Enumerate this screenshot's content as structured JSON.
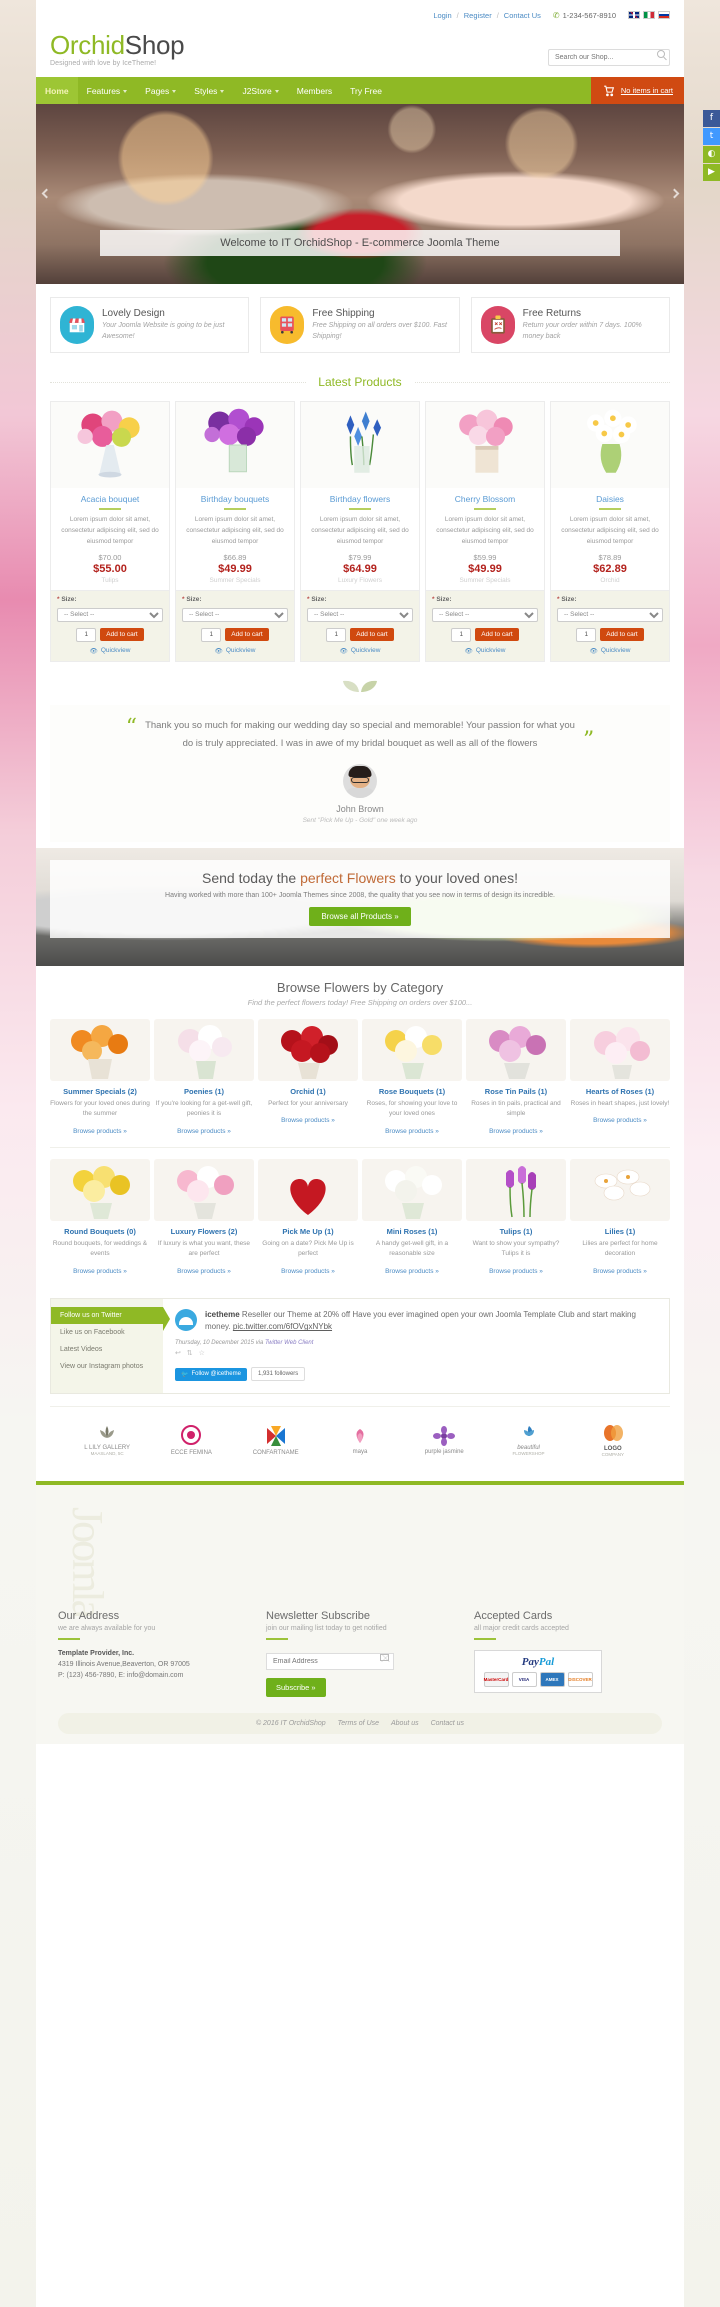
{
  "topbar": {
    "login": "Login",
    "register": "Register",
    "contact": "Contact Us",
    "phone": "1-234-567-8910",
    "separator": "/",
    "flags": [
      "flag-uk",
      "flag-it",
      "flag-ru"
    ]
  },
  "header": {
    "logo_part1": "Orchid",
    "logo_part2": "Shop",
    "tagline": "Designed with love by IceTheme!",
    "search_placeholder": "Search our Shop..."
  },
  "nav": {
    "items": [
      {
        "label": "Home",
        "caret": false,
        "active": true
      },
      {
        "label": "Features",
        "caret": true,
        "active": false
      },
      {
        "label": "Pages",
        "caret": true,
        "active": false
      },
      {
        "label": "Styles",
        "caret": true,
        "active": false
      },
      {
        "label": "J2Store",
        "caret": true,
        "active": false
      },
      {
        "label": "Members",
        "caret": false,
        "active": false
      },
      {
        "label": "Try Free",
        "caret": false,
        "active": false
      }
    ],
    "cart_label": "No items in cart"
  },
  "hero": {
    "caption": "Welcome to IT OrchidShop - E-commerce Joomla Theme"
  },
  "social": [
    {
      "name": "facebook",
      "glyph": "f"
    },
    {
      "name": "twitter",
      "glyph": "t"
    },
    {
      "name": "rss",
      "glyph": "◉"
    },
    {
      "name": "youtube",
      "glyph": "▶"
    }
  ],
  "services": [
    {
      "title": "Lovely Design",
      "text": "Your Joomla Website is going to be just Awesome!",
      "icon": "shop-icon",
      "color": "#2fb4d4"
    },
    {
      "title": "Free Shipping",
      "text": "Free Shipping on all orders over $100. Fast Shipping!",
      "icon": "bus-icon",
      "color": "#f7bb2d"
    },
    {
      "title": "Free Returns",
      "text": "Return your order within 7 days. 100% money back",
      "icon": "clipboard-icon",
      "color": "#d94665"
    }
  ],
  "latest_products": {
    "heading": "Latest Products",
    "size_label_prefix": "*",
    "size_label": " Size:",
    "select_placeholder": "-- Select --",
    "qty_value": "1",
    "add_label": "Add to cart",
    "quickview_label": "Quickview",
    "desc": "Lorem ipsum dolor sit amet, consectetur adipiscing elit, sed do eiusmod tempor",
    "items": [
      {
        "name": "Acacia bouquet",
        "old_price": "$70.00",
        "price": "$55.00",
        "category": "Tulips"
      },
      {
        "name": "Birthday bouquets",
        "old_price": "$66.89",
        "price": "$49.99",
        "category": "Summer Specials"
      },
      {
        "name": "Birthday flowers",
        "old_price": "$79.99",
        "price": "$64.99",
        "category": "Luxury Flowers"
      },
      {
        "name": "Cherry Blossom",
        "old_price": "$59.99",
        "price": "$49.99",
        "category": "Summer Specials"
      },
      {
        "name": "Daisies",
        "old_price": "$78.89",
        "price": "$62.89",
        "category": "Orchid"
      }
    ]
  },
  "testimonial": {
    "quote": "Thank you so much for making our wedding day so special and memorable! Your passion for what you do is truly appreciated. I was in awe of my bridal bouquet as well as all of the flowers",
    "open_quote": "“",
    "close_quote": "”",
    "author": "John Brown",
    "meta": "Sent \"Pick Me Up - Gold\" one week ago"
  },
  "cta": {
    "title_before": "Send today the ",
    "title_highlight": "perfect Flowers",
    "title_after": " to your loved ones!",
    "subtitle": "Having worked with more than 100+ Joomla Themes since 2008, the quality that you see now in terms of design its incredible.",
    "button": "Browse all Products »"
  },
  "categories": {
    "heading": "Browse Flowers by Category",
    "subheading": "Find the perfect flowers today! Free Shipping on orders over $100...",
    "browse_label": "Browse products »",
    "row1": [
      {
        "name": "Summer Specials (2)",
        "desc": "Flowers for your loved ones during the summer"
      },
      {
        "name": "Poenies (1)",
        "desc": "If you're looking for a get-well gift, peonies it is"
      },
      {
        "name": "Orchid (1)",
        "desc": "Perfect for your anniversary"
      },
      {
        "name": "Rose Bouquets (1)",
        "desc": "Roses, for showing your love to your loved ones"
      },
      {
        "name": "Rose Tin Pails (1)",
        "desc": "Roses in tin pails, practical and simple"
      },
      {
        "name": "Hearts of Roses (1)",
        "desc": "Roses in heart shapes, just lovely!"
      }
    ],
    "row2": [
      {
        "name": "Round Bouquets (0)",
        "desc": "Round bouquets, for weddings & events"
      },
      {
        "name": "Luxury Flowers (2)",
        "desc": "If luxury is what you want, these are perfect"
      },
      {
        "name": "Pick Me Up (1)",
        "desc": "Going on a date? Pick Me Up is perfect"
      },
      {
        "name": "Mini Roses (1)",
        "desc": "A handy get-well gift, in a reasonable size"
      },
      {
        "name": "Tulips (1)",
        "desc": "Want to show your sympathy? Tulips it is"
      },
      {
        "name": "Lilies (1)",
        "desc": "Lilies are perfect for home decoration"
      }
    ]
  },
  "twitter": {
    "side_items": [
      "Follow us on Twitter",
      "Like us on Facebook",
      "Latest Videos",
      "View our Instagram photos"
    ],
    "handle": "icetheme",
    "tweet": "Reseller our Theme at 20% off Have you ever imagined open your own Joomla Template Club and start making money.",
    "tweet_link": "pic.twitter.com/6fOVgxNYbk",
    "date": "Thursday, 10 December 2015",
    "via": "via",
    "client": "Twitter Web Client",
    "follow_button": "Follow @icetheme",
    "followers": "1,931 followers"
  },
  "brands": [
    {
      "name": "L LILY GALLERY",
      "sub": "MAASLAND, 5C"
    },
    {
      "name": "ECCE FEMINA",
      "sub": ""
    },
    {
      "name": "CONFARTNAME",
      "sub": ""
    },
    {
      "name": "maya",
      "sub": ""
    },
    {
      "name": "purple jasmine",
      "sub": ""
    },
    {
      "name": "beautiful",
      "sub": "FLOWERSHOP"
    },
    {
      "name": "LOGO",
      "sub": "COMPANY"
    }
  ],
  "footer": {
    "columns": [
      {
        "title": "Our Address",
        "subtitle": "we are always available for you",
        "company": "Template Provider, Inc.",
        "address": "4319 Illinois Avenue,Beaverton, OR 97005",
        "contact": "P: (123) 456-7890, E: info@domain.com"
      },
      {
        "title": "Newsletter Subscribe",
        "subtitle": "join our mailing list today to get notified",
        "input_placeholder": "Email Address",
        "button": "Subscribe »"
      },
      {
        "title": "Accepted Cards",
        "subtitle": "all major credit cards accepted",
        "paypal_pay": "Pay",
        "paypal_pal": "Pal",
        "cards": [
          "MasterCard",
          "VISA",
          "AMEX",
          "DISCOVER"
        ]
      }
    ],
    "copyright": "© 2016 IT OrchidShop",
    "links": [
      "Terms of Use",
      "About us",
      "Contact us"
    ],
    "watermark": "Joomla"
  }
}
